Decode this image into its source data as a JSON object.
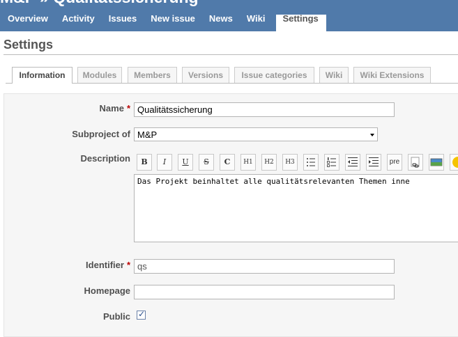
{
  "header": {
    "project_title": "M&P » Qualitätssicherung",
    "menu": [
      "Overview",
      "Activity",
      "Issues",
      "New issue",
      "News",
      "Wiki",
      "Settings"
    ],
    "selected_menu": "Settings"
  },
  "page": {
    "title": "Settings"
  },
  "tabs": [
    "Information",
    "Modules",
    "Members",
    "Versions",
    "Issue categories",
    "Wiki",
    "Wiki Extensions"
  ],
  "selected_tab": "Information",
  "form": {
    "name_label": "Name",
    "required_marker": "*",
    "name_value": "Qualitätssicherung",
    "subproject_label": "Subproject of",
    "subproject_value": "M&P",
    "description_label": "Description",
    "description_value": "Das Projekt beinhaltet alle qualitätsrelevanten Themen inne",
    "identifier_label": "Identifier",
    "identifier_value": "qs",
    "homepage_label": "Homepage",
    "homepage_value": "",
    "public_label": "Public",
    "public_checked": true
  },
  "toolbar": {
    "bold": "B",
    "italic": "I",
    "underline": "U",
    "strike": "S",
    "code": "C",
    "h1": "H1",
    "h2": "H2",
    "h3": "H3",
    "pre": "pre"
  },
  "colors": {
    "header_bg": "#507aaa",
    "required": "#bb0000",
    "box_bg": "#f6f6f6"
  }
}
